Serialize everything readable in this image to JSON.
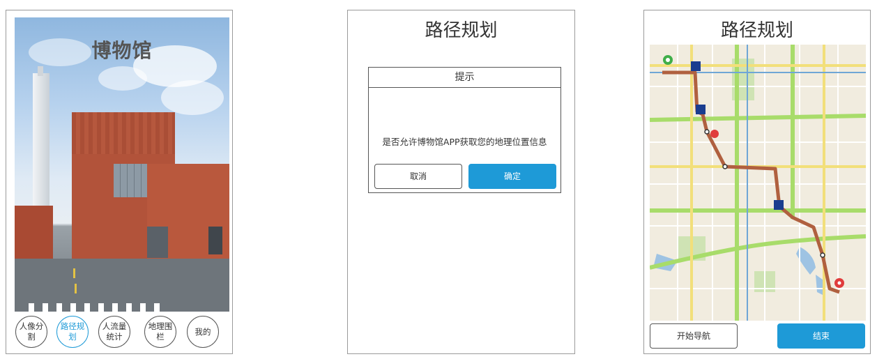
{
  "screen1": {
    "hero_title": "博物馆",
    "nav": [
      {
        "label": "人像分割",
        "active": false
      },
      {
        "label": "路径规划",
        "active": true
      },
      {
        "label": "人流量统计",
        "active": false
      },
      {
        "label": "地理围栏",
        "active": false
      },
      {
        "label": "我的",
        "active": false
      }
    ]
  },
  "screen2": {
    "title": "路径规划",
    "dialog": {
      "header": "提示",
      "message": "是否允许博物馆APP获取您的地理位置信息",
      "cancel_label": "取消",
      "confirm_label": "确定"
    }
  },
  "screen3": {
    "title": "路径规划",
    "start_nav_label": "开始导航",
    "end_label": "结束"
  },
  "colors": {
    "primary": "#1e9ad7",
    "route": "#b0603f",
    "building": "#b2533a"
  }
}
